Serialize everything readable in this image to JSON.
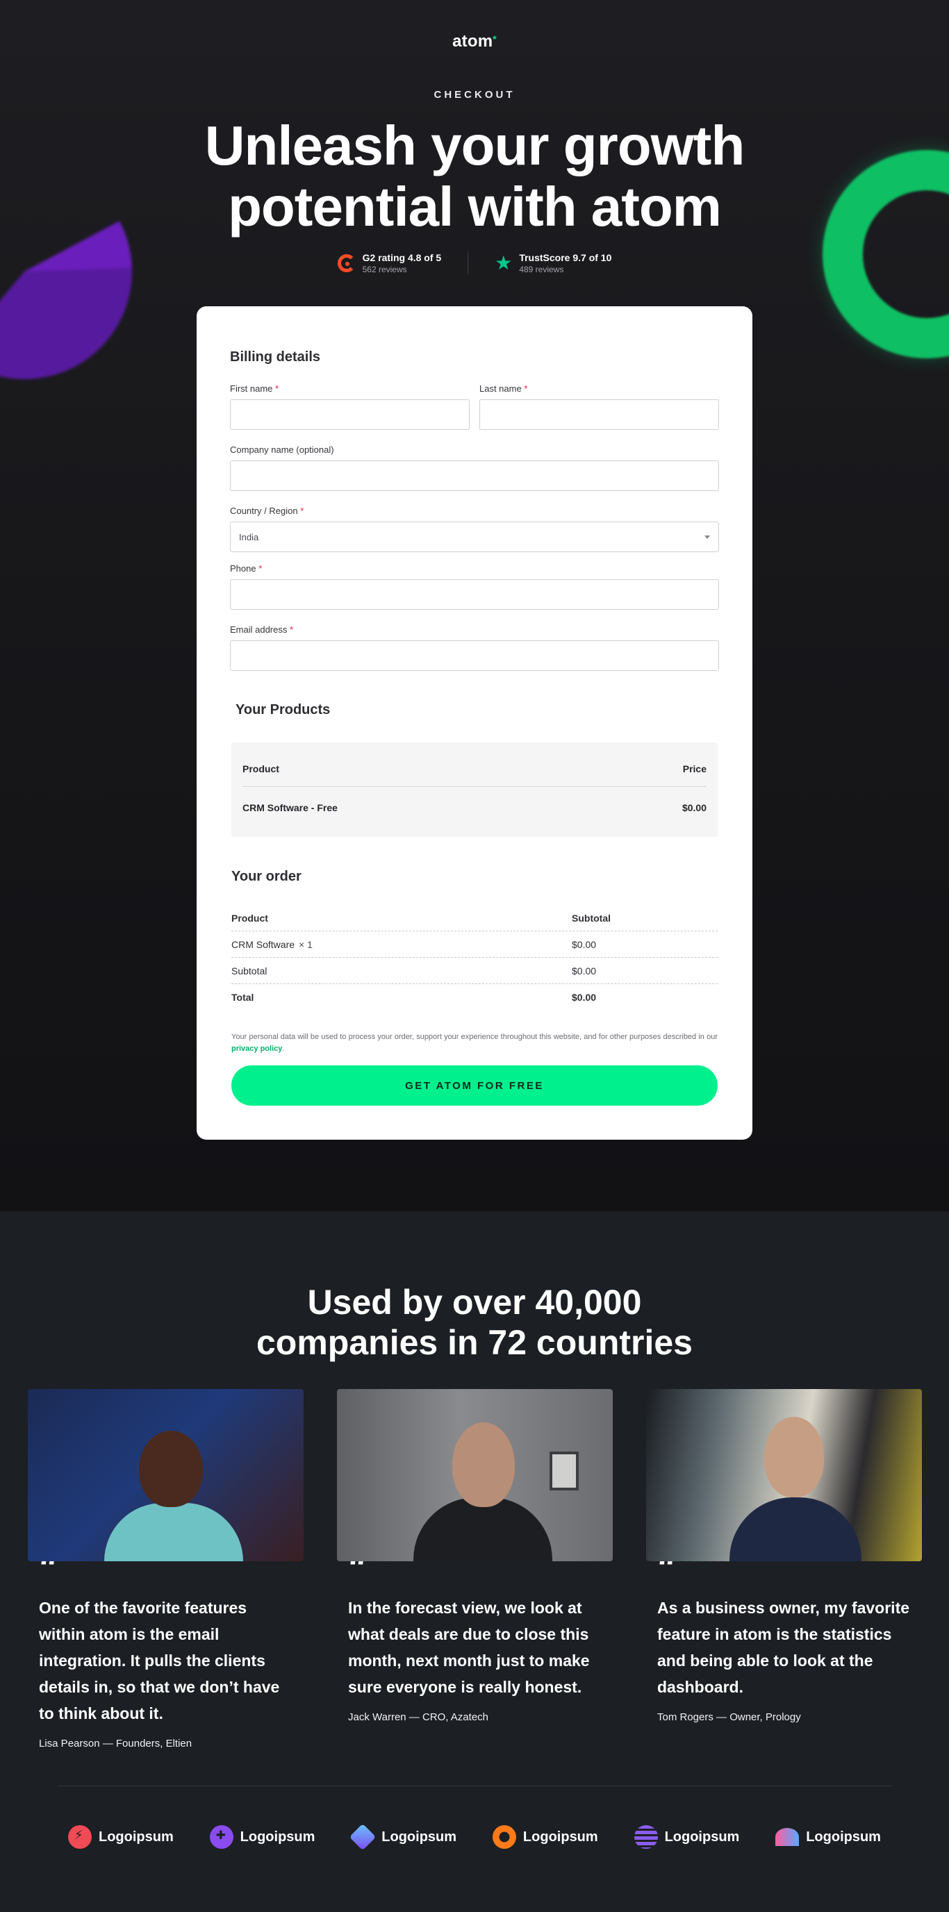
{
  "brand": {
    "name": "atom",
    "mark": "*"
  },
  "hero": {
    "eyebrow": "CHECKOUT",
    "headline_line1": "Unleash your growth",
    "headline_line2": "potential with atom",
    "ratings": [
      {
        "title": "G2 rating 4.8 of 5",
        "sub": "562 reviews",
        "icon": "g2-icon"
      },
      {
        "title": "TrustScore 9.7 of 10",
        "sub": "489 reviews",
        "icon": "star-icon"
      }
    ]
  },
  "billing": {
    "title": "Billing details",
    "required_mark": "*",
    "first_name": {
      "label": "First name",
      "value": ""
    },
    "last_name": {
      "label": "Last name",
      "value": ""
    },
    "company": {
      "label": "Company name (optional)",
      "value": ""
    },
    "country": {
      "label": "Country / Region",
      "value": "India"
    },
    "phone": {
      "label": "Phone",
      "value": ""
    },
    "email": {
      "label": "Email address",
      "value": ""
    }
  },
  "products": {
    "title": "Your Products",
    "col_product": "Product",
    "col_price": "Price",
    "rows": [
      {
        "name": "CRM Software - Free",
        "price": "$0.00"
      }
    ]
  },
  "order": {
    "title": "Your order",
    "col_product": "Product",
    "col_subtotal": "Subtotal",
    "item_name": "CRM Software",
    "item_qty": "× 1",
    "item_price": "$0.00",
    "subtotal_label": "Subtotal",
    "subtotal_value": "$0.00",
    "total_label": "Total",
    "total_value": "$0.00"
  },
  "privacy": {
    "text": "Your personal data will be used to process your order, support your experience throughout this website, and for other purposes described in our ",
    "link": "privacy policy",
    "end": "."
  },
  "cta": {
    "label": "GET ATOM FOR FREE"
  },
  "social": {
    "title_line1": "Used by over 40,000",
    "title_line2": "companies in 72 countries",
    "testimonials": [
      {
        "quote": "One of the favorite features within atom is the email integration. It pulls the clients details in, so that we don’t have to think about it.",
        "author": "Lisa Pearson — Founders, Eltien"
      },
      {
        "quote": "In the forecast view, we look at what deals are due to close this month, next month just to make sure everyone is really honest.",
        "author": "Jack Warren — CRO, Azatech"
      },
      {
        "quote": "As a business owner, my favorite feature in atom is the statistics and being able to look at the dashboard.",
        "author": "Tom Rogers — Owner, Prology"
      }
    ],
    "logos": [
      "Logoipsum",
      "Logoipsum",
      "Logoipsum",
      "Logoipsum",
      "Logoipsum",
      "Logoipsum"
    ]
  },
  "colors": {
    "accent": "#00f08d",
    "required": "#e0223a",
    "background": "#1c1c20"
  }
}
